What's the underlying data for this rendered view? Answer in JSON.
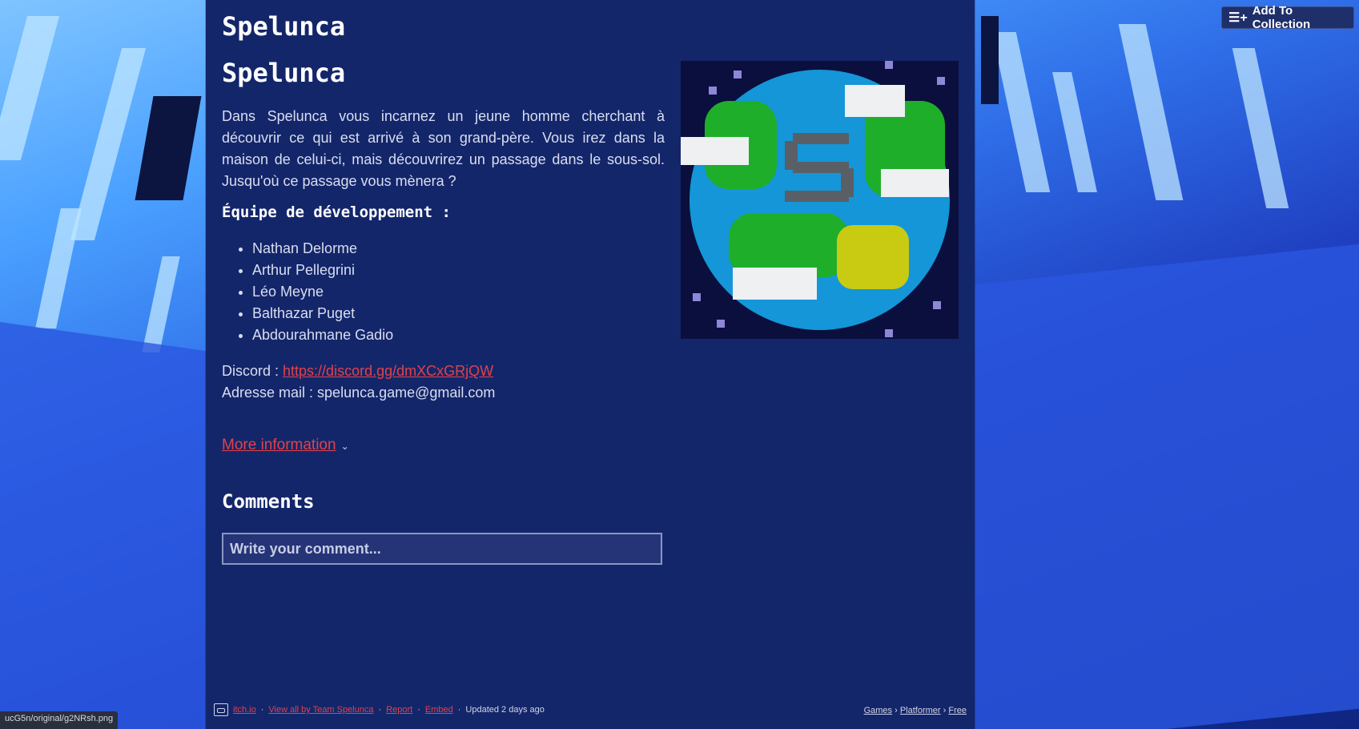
{
  "header": {
    "add_collection_label": "Add To Collection",
    "add_collection_icon": "playlist-add-icon"
  },
  "game": {
    "title": "Spelunca",
    "description_title": "Spelunca",
    "description": "Dans Spelunca vous incarnez un jeune homme cherchant à découvrir ce qui est arrivé à son grand-père. Vous irez dans la maison de celui-ci, mais découvrirez un passage dans le sous-sol. Jusqu'où ce passage vous mènera ?",
    "team_heading": "Équipe de développement :",
    "team": [
      "Nathan Delorme",
      "Arthur Pellegrini",
      "Léo Meyne",
      "Balthazar Puget",
      "Abdourahmane Gadio"
    ],
    "discord_label": "Discord : ",
    "discord_link": "https://discord.gg/dmXCxGRjQW",
    "email_label": "Adresse mail : ",
    "email": "spelunca.game@gmail.com",
    "more_info_label": "More information"
  },
  "comments": {
    "heading": "Comments",
    "placeholder": "Write your comment..."
  },
  "footer": {
    "site": "itch.io",
    "view_all": "View all by Team Spelunca",
    "report": "Report",
    "embed": "Embed",
    "updated": "Updated 2 days ago",
    "sep": "·",
    "breadcrumbs": [
      "Games",
      "Platformer",
      "Free"
    ],
    "crumb_sep": "›"
  },
  "status_bar": {
    "url": "ucG5n/original/g2NRsh.png"
  },
  "colors": {
    "panel": "#14266a",
    "link": "#e0424a",
    "text": "#d8def0"
  }
}
